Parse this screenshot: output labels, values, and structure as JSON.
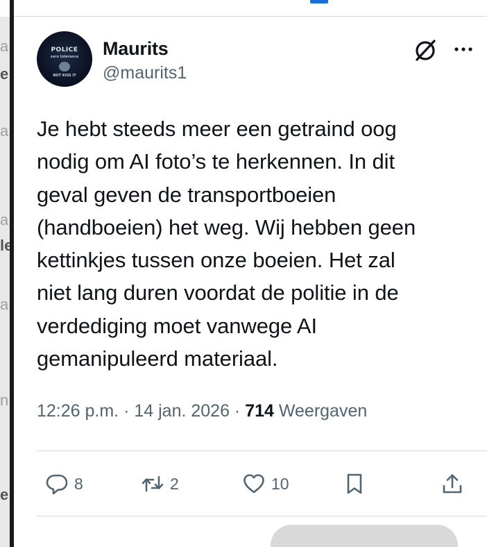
{
  "left_fragments": [
    "a",
    "e",
    "a",
    "a",
    "le",
    "a",
    "n",
    "e"
  ],
  "tweet": {
    "author_name": "Maurits",
    "author_handle": "@maurits1",
    "avatar": {
      "line1": "POLICE",
      "line2": "zero tolerance",
      "line3": "NOT KISS IT"
    },
    "text": "Je hebt steeds meer een getraind oog\nnodig om AI foto’s te herkennen. In dit\ngeval geven de transportboeien\n(handboeien) het weg. Wij hebben geen\nkettinkjes tussen onze boeien. Het zal\nniet lang duren voordat de politie in de\nverdediging moet vanwege AI\ngemanipuleerd materiaal.",
    "time": "12:26 p.m.",
    "separator": " · ",
    "date": "14 jan. 2026",
    "views_count": "714",
    "views_label": " Weergaven",
    "actions": {
      "reply_count": "8",
      "retweet_count": "2",
      "like_count": "10"
    }
  },
  "icons": {
    "grok": "grok-icon",
    "more": "more-icon",
    "reply": "reply-icon",
    "retweet": "retweet-icon",
    "like": "heart-icon",
    "bookmark": "bookmark-icon",
    "share": "share-icon"
  },
  "colors": {
    "text_primary": "#0f1419",
    "text_secondary": "#536471",
    "divider": "#cfd9de",
    "tab_indicator": "#1d6fd8"
  }
}
